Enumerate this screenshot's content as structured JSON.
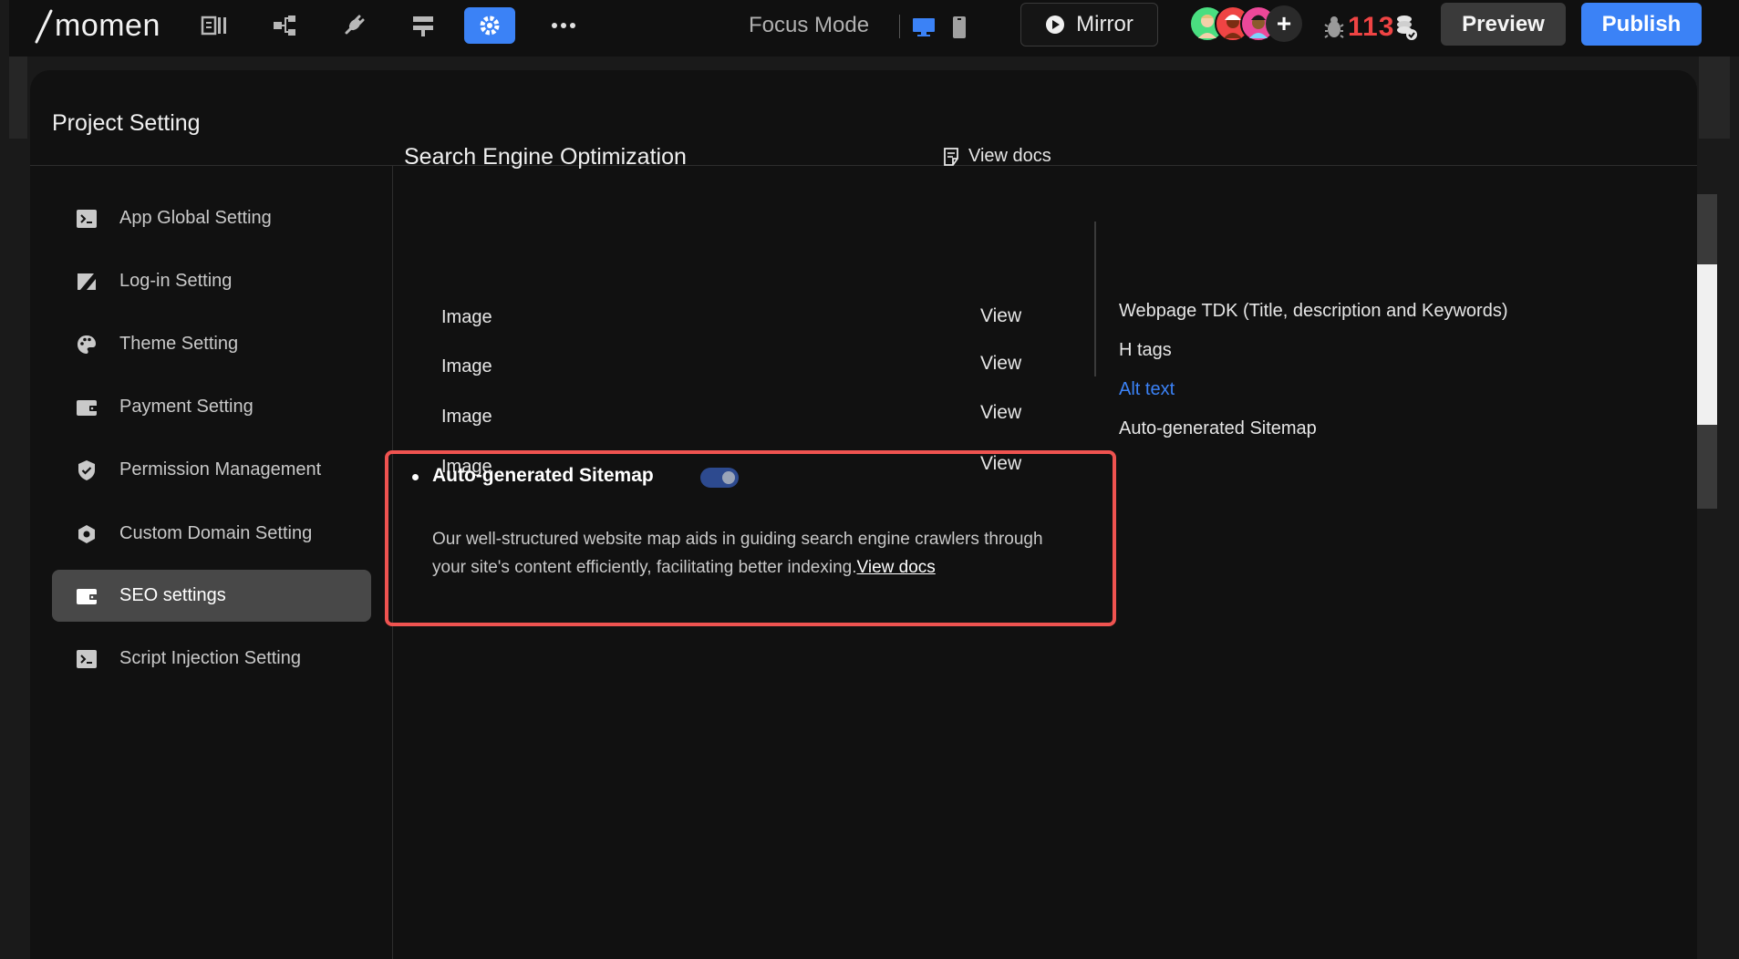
{
  "topbar": {
    "logo_text": "momen",
    "focus_mode_label": "Focus Mode",
    "mirror_label": "Mirror",
    "bug_count": "113",
    "preview_label": "Preview",
    "publish_label": "Publish",
    "accent_color": "#3b82f6",
    "toolbar_icons": [
      "pages-icon",
      "data-model-icon",
      "plugin-icon",
      "actionflow-icon",
      "gear-icon",
      "more-icon"
    ],
    "active_toolbar_icon": "gear-icon",
    "active_device": "desktop-icon"
  },
  "modal": {
    "title": "Project Setting"
  },
  "sidebar": {
    "items": [
      {
        "label": "App Global Setting",
        "icon": "terminal-icon"
      },
      {
        "label": "Log-in Setting",
        "icon": "login-icon"
      },
      {
        "label": "Theme Setting",
        "icon": "palette-icon"
      },
      {
        "label": "Payment Setting",
        "icon": "wallet-icon"
      },
      {
        "label": "Permission Management",
        "icon": "shield-icon"
      },
      {
        "label": "Custom Domain Setting",
        "icon": "domain-icon"
      },
      {
        "label": "SEO settings",
        "icon": "seo-icon",
        "active": true
      },
      {
        "label": "Script Injection Setting",
        "icon": "terminal-icon"
      }
    ]
  },
  "seo": {
    "title": "Search Engine Optimization",
    "view_docs_label": "View docs",
    "image_rows": [
      {
        "label": "Image",
        "action": "View"
      },
      {
        "label": "Image",
        "action": "View"
      },
      {
        "label": "Image",
        "action": "View"
      },
      {
        "label": "Image",
        "action": "View"
      }
    ],
    "toc": [
      {
        "label": "Webpage TDK (Title, description and Keywords)"
      },
      {
        "label": "H tags"
      },
      {
        "label": "Alt text",
        "current": true
      },
      {
        "label": "Auto-generated Sitemap"
      }
    ],
    "sitemap": {
      "heading": "Auto-generated Sitemap",
      "enabled": true,
      "description": "Our well-structured website map aids in guiding search engine crawlers through your site's content efficiently, facilitating better indexing.",
      "link_label": "View docs"
    }
  }
}
